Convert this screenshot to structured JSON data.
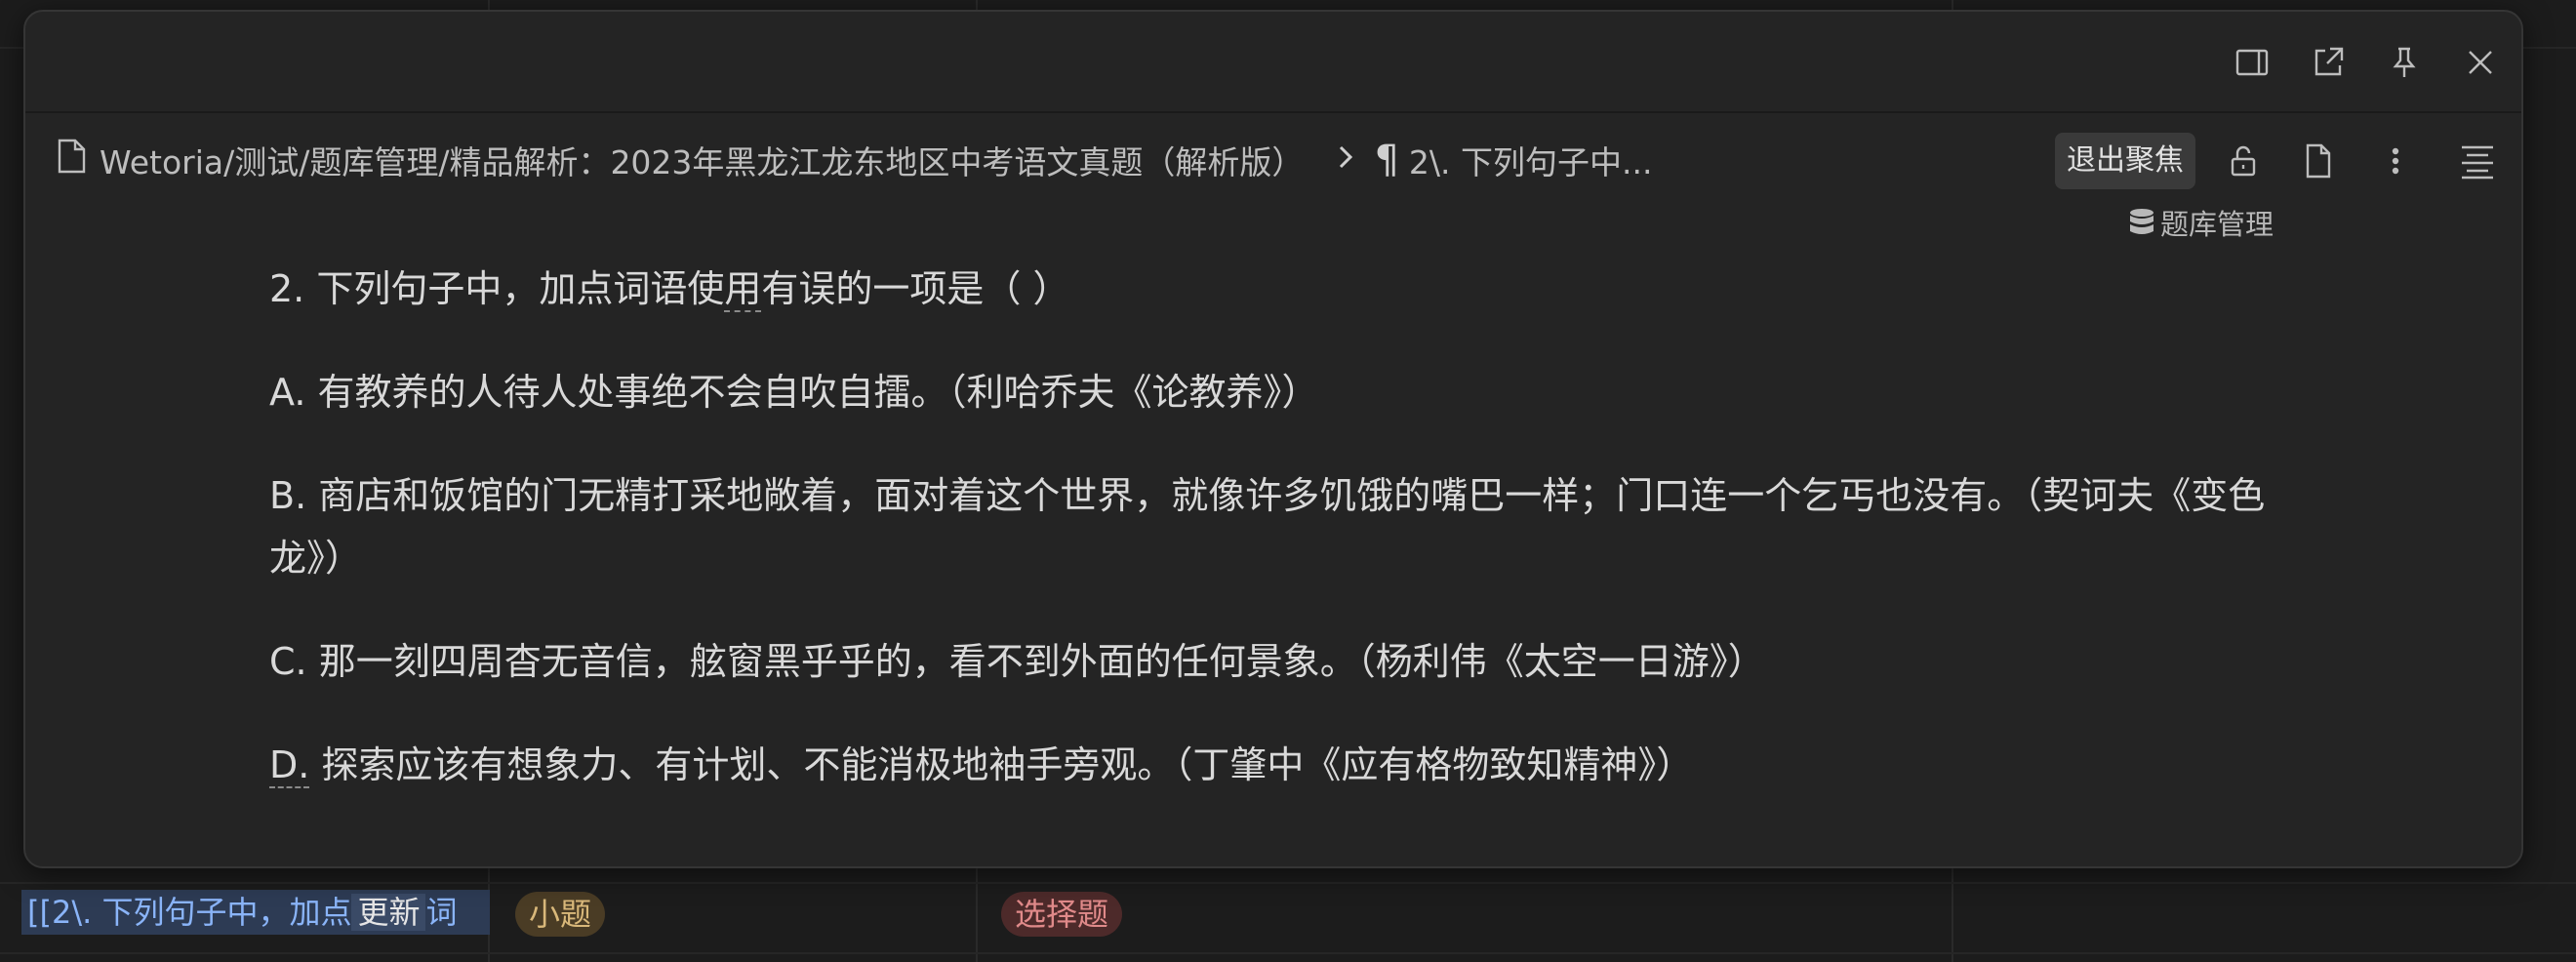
{
  "background": {
    "row_link_text": "[[2\\. 下列句子中，加点",
    "row_link_update": "更新",
    "row_link_tail": "词",
    "tag_xiaoti": "小题",
    "tag_xuanze": "选择题"
  },
  "titlebar": {
    "icons": [
      "sidebar-toggle-icon",
      "open-external-icon",
      "pin-icon",
      "close-icon"
    ]
  },
  "header": {
    "breadcrumb_path": "Wetoria/测试/题库管理/精品解析：2023年黑龙江龙东地区中考语文真题（解析版）",
    "pilcrow": "¶",
    "heading_crumb": "2\\. 下列句子中...",
    "exit_focus_label": "退出聚焦",
    "db_tag_label": "题库管理"
  },
  "content": {
    "question_pre": "2. 下列句子中，加点词语使",
    "question_dot": "用",
    "question_post": "有误的一项是（ ）",
    "option_a": "A. 有教养的人待人处事绝不会自吹自擂。（利哈乔夫《论教养》）",
    "option_b": "B. 商店和饭馆的门无精打采地敞着，面对着这个世界，就像许多饥饿的嘴巴一样；门口连一个乞丐也没有。（契诃夫《变色龙》）",
    "option_c": "C. 那一刻四周杳无音信，舷窗黑乎乎的，看不到外面的任何景象。（杨利伟《太空一日游》）",
    "option_d_dot": "D.",
    "option_d_rest": " 探索应该有想象力、有计划、不能消极地袖手旁观。（丁肇中《应有格物致知精神》）"
  }
}
